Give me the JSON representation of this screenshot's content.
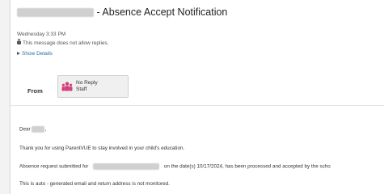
{
  "email": {
    "subject": "- Absence Accept Notification",
    "datetime": "Wednesday 3:33 PM",
    "no_reply_notice": "This message does not allow replies.",
    "show_details": "Show Details",
    "from_label": "From",
    "sender_name_line1": "No Reply",
    "sender_name_line2": "Staff",
    "body": {
      "greeting": "Dear",
      "greeting_end": ",",
      "line1": "Thank you for using ParentVUE to stay involved in your child's education.",
      "line2_pre": "Absence request submitted for",
      "line2_post": "on the date(s) 10/17/2024, has been processed and accepted by the scho",
      "line3": "This is auto - generated email and return address is not monitored."
    }
  },
  "colors": {
    "link": "#2b6cb0",
    "icon_pink": "#d0407a"
  }
}
